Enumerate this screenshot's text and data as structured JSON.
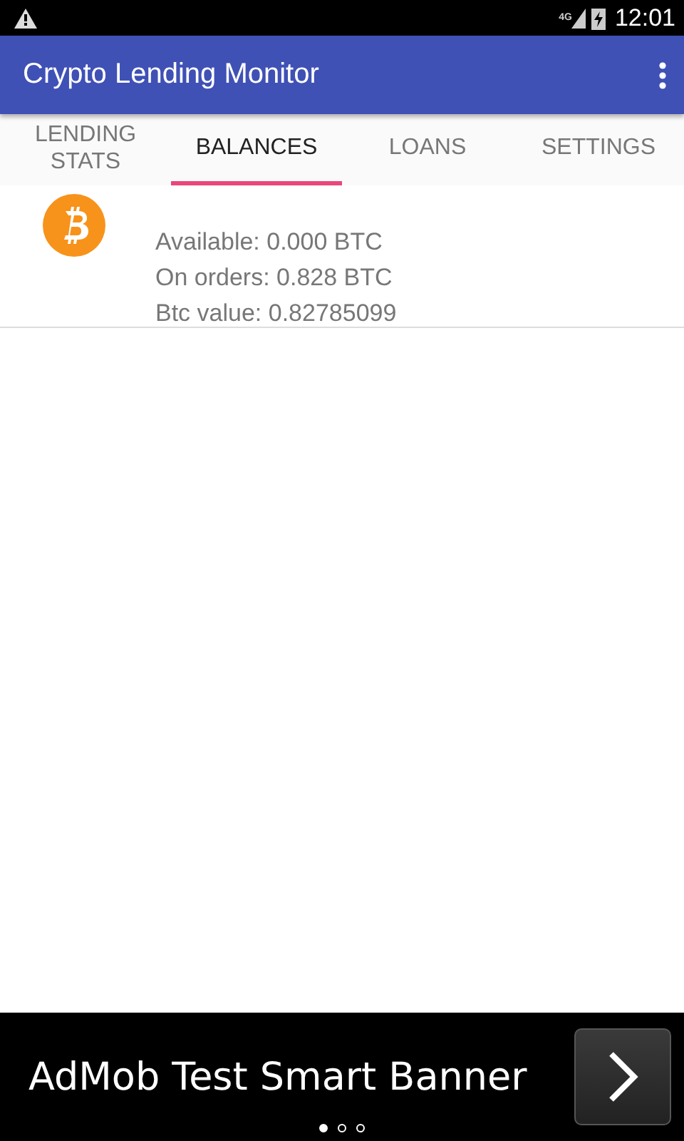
{
  "status_bar": {
    "network": "4G",
    "time": "12:01"
  },
  "app_bar": {
    "title": "Crypto Lending Monitor"
  },
  "tabs": [
    {
      "label": "LENDING STATS",
      "selected": false
    },
    {
      "label": "BALANCES",
      "selected": true
    },
    {
      "label": "LOANS",
      "selected": false
    },
    {
      "label": "SETTINGS",
      "selected": false
    }
  ],
  "balances": [
    {
      "lines": [
        "Available: 0.000 BTC",
        "On orders: 0.828 BTC",
        "Btc value: 0.82785099"
      ]
    }
  ],
  "ad_banner": {
    "text": "AdMob Test Smart Banner",
    "pages": [
      {
        "selected": true
      },
      {
        "selected": false
      },
      {
        "selected": false
      }
    ]
  }
}
